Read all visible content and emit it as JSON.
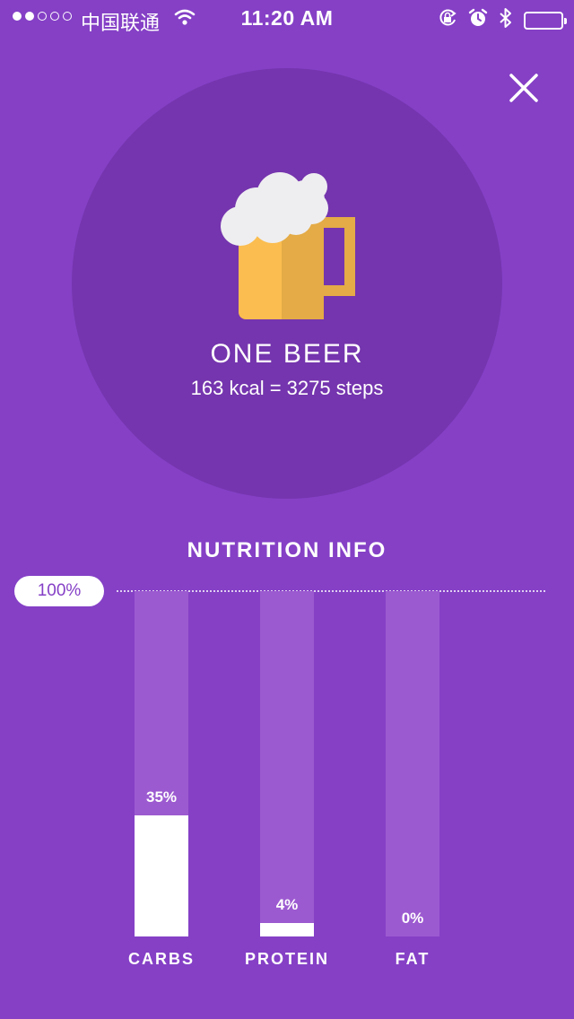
{
  "status_bar": {
    "carrier": "中国联通",
    "time": "11:20 AM",
    "icons": [
      "signal-dots-icon",
      "wifi-icon",
      "rotation-lock-icon",
      "alarm-icon",
      "bluetooth-icon",
      "battery-icon"
    ]
  },
  "header": {
    "close_icon": "close-icon"
  },
  "item": {
    "icon": "beer-mug-icon",
    "title": "ONE BEER",
    "subtitle": "163 kcal = 3275 steps"
  },
  "nutrition": {
    "title": "NUTRITION INFO",
    "max_label": "100%",
    "bars": [
      {
        "label": "CARBS",
        "percent": 35,
        "value_label": "35%"
      },
      {
        "label": "PROTEIN",
        "percent": 4,
        "value_label": "4%"
      },
      {
        "label": "FAT",
        "percent": 0,
        "value_label": "0%"
      }
    ]
  },
  "colors": {
    "background": "#8540c6",
    "circle": "#7535ae",
    "bar_track": "#9c5ad0",
    "bar_fill": "#ffffff",
    "beer_body": "#fbbd4f",
    "beer_shade": "#e4ab46",
    "foam": "#eeeef0"
  }
}
